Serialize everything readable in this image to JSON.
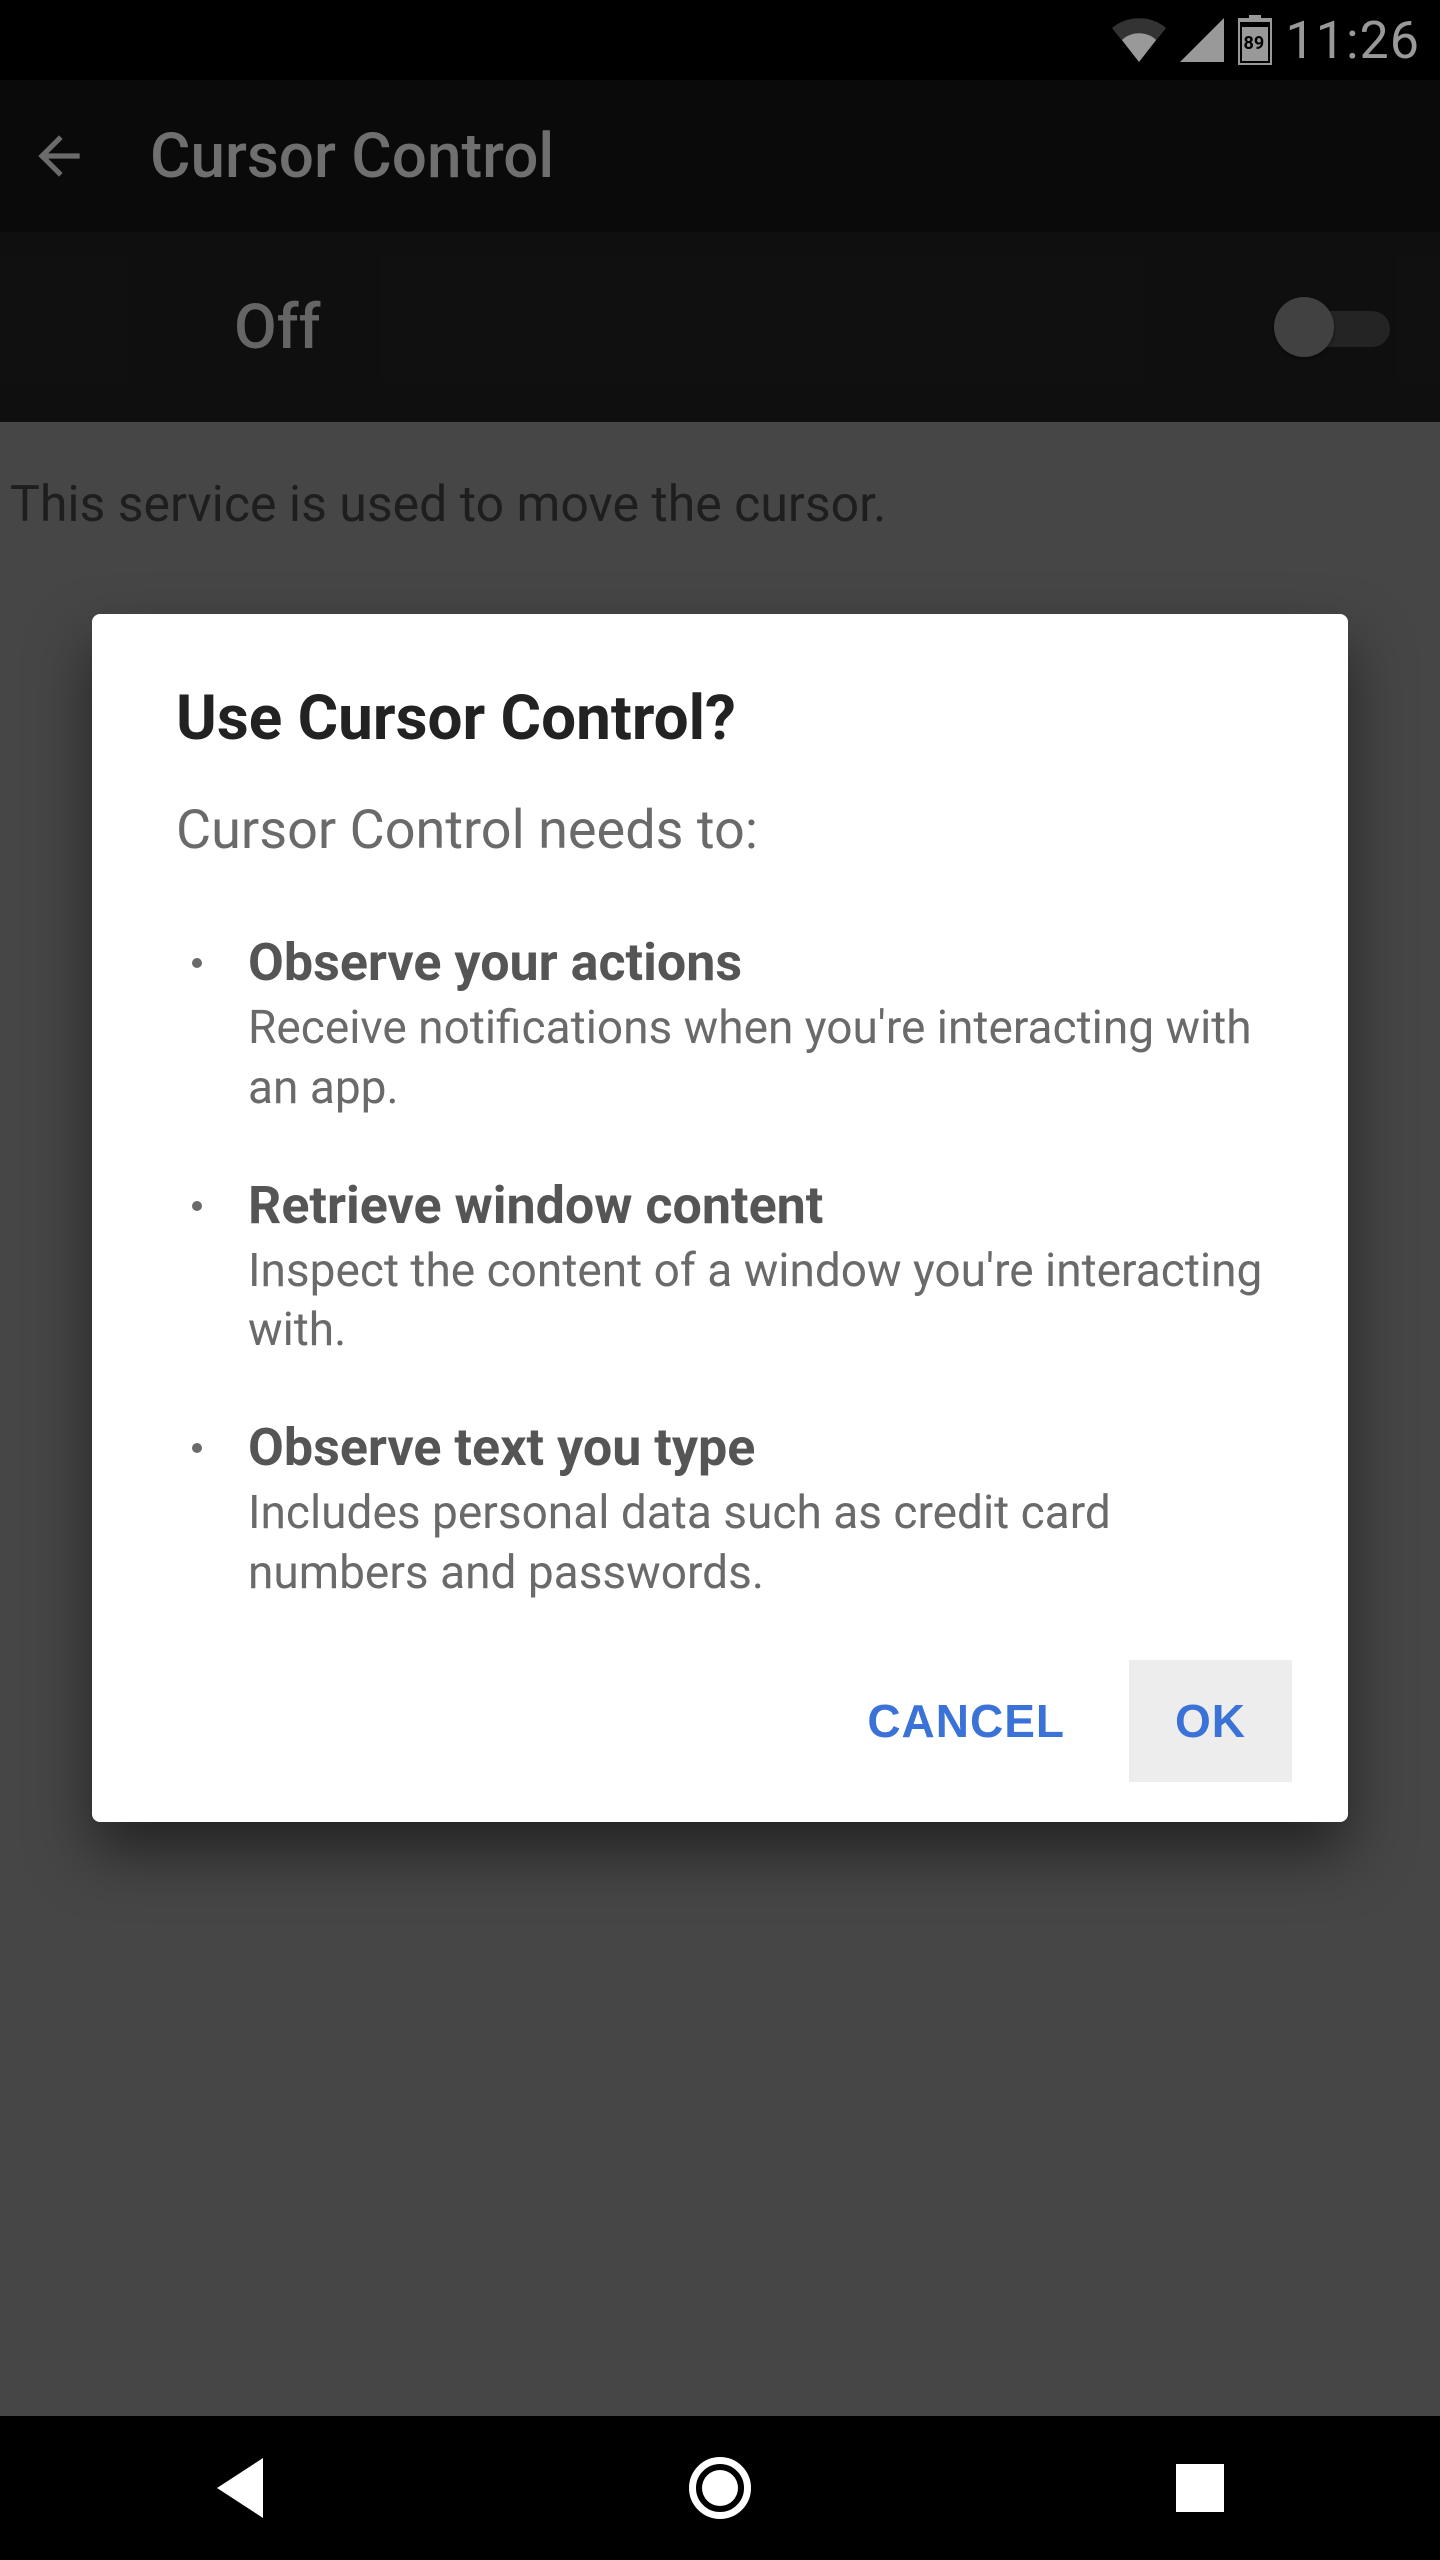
{
  "status": {
    "time": "11:26",
    "battery_level": "89"
  },
  "appbar": {
    "title": "Cursor Control"
  },
  "toggle": {
    "state_label": "Off",
    "on": false
  },
  "page": {
    "description": "This service is used to move the cursor."
  },
  "dialog": {
    "title": "Use Cursor Control?",
    "subtitle": "Cursor Control needs to:",
    "permissions": [
      {
        "title": "Observe your actions",
        "desc": "Receive notifications when you're interacting with an app."
      },
      {
        "title": "Retrieve window content",
        "desc": "Inspect the content of a window you're interacting with."
      },
      {
        "title": "Observe text you type",
        "desc": "Includes personal data such as credit card numbers and passwords."
      }
    ],
    "cancel_label": "CANCEL",
    "ok_label": "OK"
  }
}
